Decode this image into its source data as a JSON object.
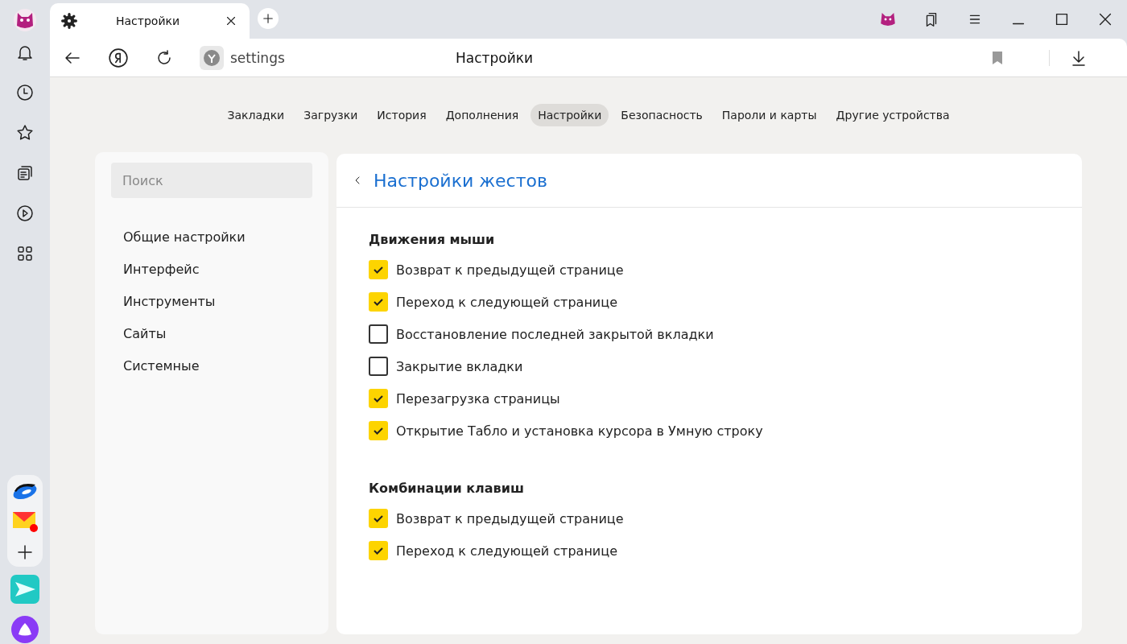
{
  "tab": {
    "title": "Настройки"
  },
  "address": {
    "text": "settings",
    "page_title": "Настройки"
  },
  "nav": [
    {
      "label": "Закладки",
      "selected": false
    },
    {
      "label": "Загрузки",
      "selected": false
    },
    {
      "label": "История",
      "selected": false
    },
    {
      "label": "Дополнения",
      "selected": false
    },
    {
      "label": "Настройки",
      "selected": true
    },
    {
      "label": "Безопасность",
      "selected": false
    },
    {
      "label": "Пароли и карты",
      "selected": false
    },
    {
      "label": "Другие устройства",
      "selected": false
    }
  ],
  "sidebar": {
    "search": {
      "placeholder": "Поиск"
    },
    "items": [
      "Общие настройки",
      "Интерфейс",
      "Инструменты",
      "Сайты",
      "Системные"
    ]
  },
  "panel": {
    "title": "Настройки жестов",
    "sections": [
      {
        "heading": "Движения мыши",
        "options": [
          {
            "label": "Возврат к предыдущей странице",
            "checked": true
          },
          {
            "label": "Переход к следующей странице",
            "checked": true
          },
          {
            "label": "Восстановление последней закрытой вкладки",
            "checked": false
          },
          {
            "label": "Закрытие вкладки",
            "checked": false
          },
          {
            "label": "Перезагрузка страницы",
            "checked": true
          },
          {
            "label": "Открытие Табло и установка курсора в Умную строку",
            "checked": true
          }
        ]
      },
      {
        "heading": "Комбинации клавиш",
        "options": [
          {
            "label": "Возврат к предыдущей странице",
            "checked": true
          },
          {
            "label": "Переход к следующей странице",
            "checked": true
          }
        ]
      }
    ]
  }
}
